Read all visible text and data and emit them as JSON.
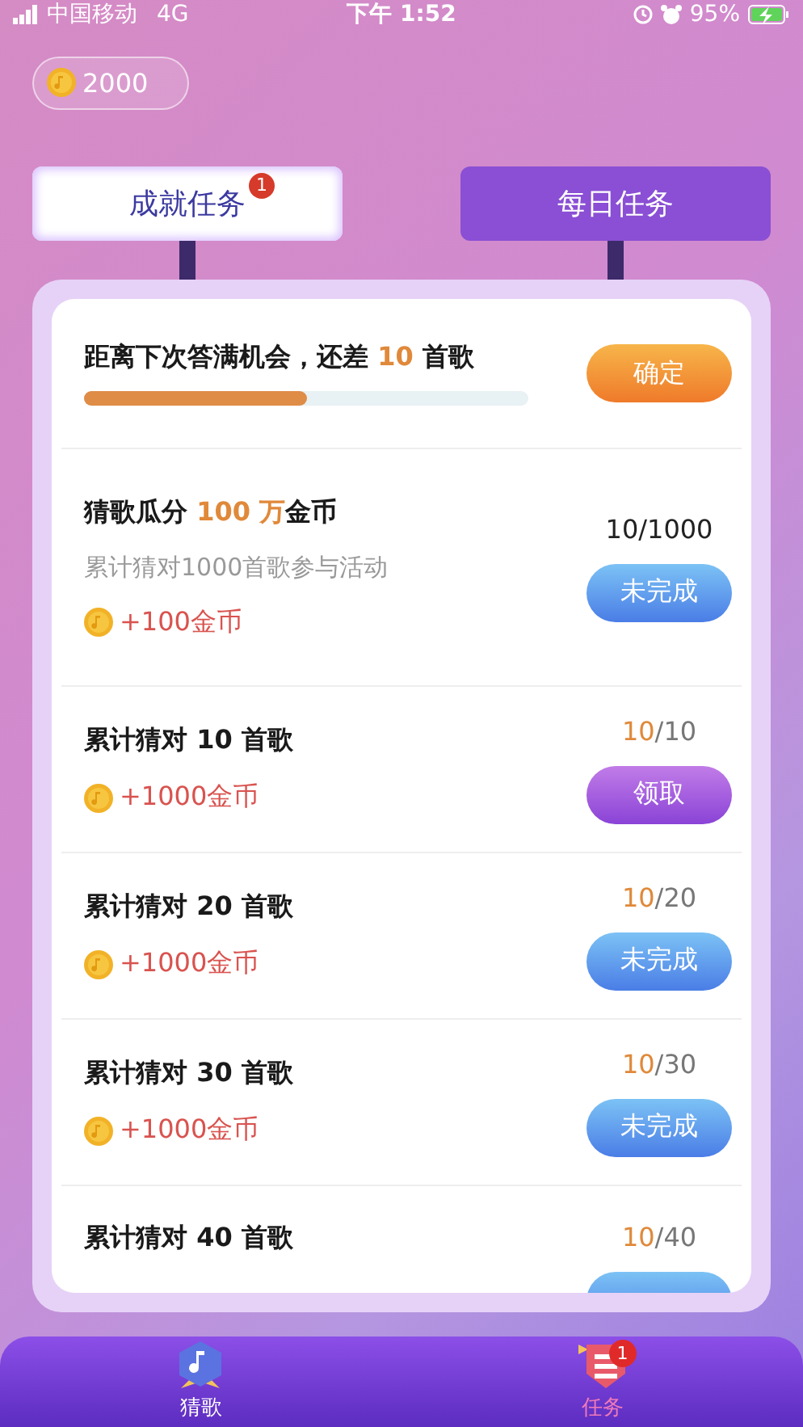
{
  "status_bar": {
    "carrier": "中国移动",
    "network": "4G",
    "time": "下午 1:52",
    "battery": "95%",
    "charging": true
  },
  "coins": {
    "amount": "2000"
  },
  "tabs": [
    {
      "label": "成就任务",
      "selected": true,
      "badge": "1"
    },
    {
      "label": "每日任务",
      "selected": false
    }
  ],
  "next_chance": {
    "title": [
      {
        "text": "距离下次答满机会，还差 ",
        "accent": false
      },
      {
        "text": "10",
        "accent": true
      },
      {
        "text": " 首歌",
        "accent": false
      }
    ],
    "level": 0.5,
    "button": {
      "kind": "confirm",
      "label": "确定"
    }
  },
  "tasks": [
    {
      "title": [
        {
          "text": "猜歌瓜分 ",
          "accent": false
        },
        {
          "text": "100 万",
          "accent": true
        },
        {
          "text": "金币",
          "accent": false
        }
      ],
      "progress_current": "10/1000",
      "highlight": false,
      "description": "累计猜对1000首歌参与活动",
      "reward": "+100金币",
      "button": {
        "kind": "incomplete",
        "label": "未完成"
      }
    },
    {
      "title": [
        {
          "text": "累计猜对 10 首歌",
          "accent": false
        }
      ],
      "progress_current": "10",
      "progress_rest": "/10",
      "highlight": true,
      "reward": "+1000金币",
      "button": {
        "kind": "claim",
        "label": "领取"
      }
    },
    {
      "title": [
        {
          "text": "累计猜对 20 首歌",
          "accent": false
        }
      ],
      "progress_current": "10",
      "progress_rest": "/20",
      "highlight": true,
      "reward": "+1000金币",
      "button": {
        "kind": "incomplete",
        "label": "未完成"
      }
    },
    {
      "title": [
        {
          "text": "累计猜对 30 首歌",
          "accent": false
        }
      ],
      "progress_current": "10",
      "progress_rest": "/30",
      "highlight": true,
      "reward": "+1000金币",
      "button": {
        "kind": "incomplete",
        "label": "未完成"
      }
    },
    {
      "title": [
        {
          "text": "累计猜对 40 首歌",
          "accent": false
        }
      ],
      "progress_current": "10",
      "progress_rest": "/40",
      "highlight": true,
      "button": {
        "kind": "incomplete"
      }
    }
  ],
  "bottom_nav": [
    {
      "label": "猜歌",
      "selected": false
    },
    {
      "label": "任务",
      "selected": true,
      "badge": "1"
    }
  ]
}
